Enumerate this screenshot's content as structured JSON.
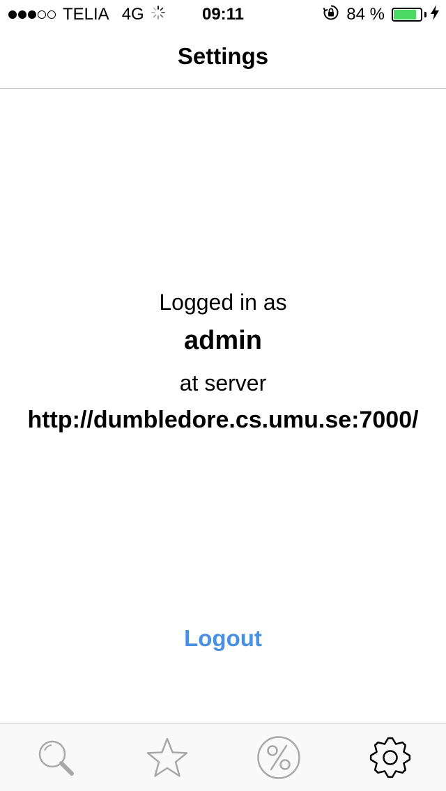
{
  "status_bar": {
    "carrier": "TELIA",
    "network": "4G",
    "time": "09:11",
    "battery_percent": "84 %",
    "battery_level": 0.84,
    "battery_color": "#4cd964",
    "signal_strength": 3,
    "signal_max": 5
  },
  "nav": {
    "title": "Settings"
  },
  "session": {
    "logged_in_label": "Logged in as",
    "username": "admin",
    "at_server_label": "at server",
    "server_url": "http://dumbledore.cs.umu.se:7000/"
  },
  "actions": {
    "logout_label": "Logout",
    "accent_color": "#4a90e2"
  },
  "tab_bar": {
    "tabs": [
      {
        "icon": "search-icon",
        "active": false
      },
      {
        "icon": "star-icon",
        "active": false
      },
      {
        "icon": "percent-icon",
        "active": false
      },
      {
        "icon": "gear-icon",
        "active": true
      }
    ],
    "inactive_color": "#a8a8a8",
    "active_color": "#000000"
  }
}
